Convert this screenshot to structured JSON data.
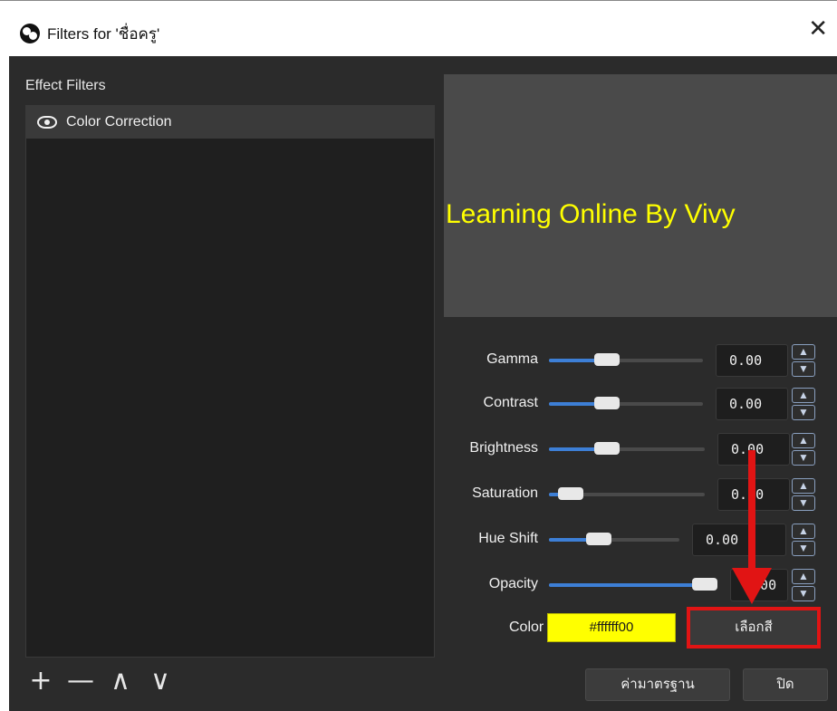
{
  "window": {
    "title": "Filters for 'ชื่อครู'",
    "close_glyph": "✕"
  },
  "effect_filters": {
    "label": "Effect Filters",
    "items": [
      {
        "label": "Color Correction",
        "icon": "eye-icon"
      }
    ]
  },
  "toolbar": {
    "add_glyph": "+",
    "remove_glyph": "—",
    "up_glyph": "∧",
    "down_glyph": "∨"
  },
  "preview": {
    "text": "Learning Online By Vivy",
    "text_color": "#ffff00"
  },
  "properties": [
    {
      "label": "Gamma",
      "value": "0.00",
      "level": 0.5
    },
    {
      "label": "Contrast",
      "value": "0.00",
      "level": 0.5
    },
    {
      "label": "Brightness",
      "value": "0.00",
      "level": 0.5
    },
    {
      "label": "Saturation",
      "value": "0.00",
      "level": 0.1
    },
    {
      "label": "Hue Shift",
      "value": "0.00",
      "level": 0.5
    },
    {
      "label": "Opacity",
      "value": "0.00",
      "level": 1.0
    }
  ],
  "color": {
    "label": "Color",
    "value": "#ffffff00",
    "swatch": "#ffff00",
    "select_button": "เลือกสี"
  },
  "footer": {
    "defaults_button": "ค่ามาตรฐาน",
    "close_button": "ปิด"
  },
  "annotation": {
    "color": "#e11414"
  }
}
